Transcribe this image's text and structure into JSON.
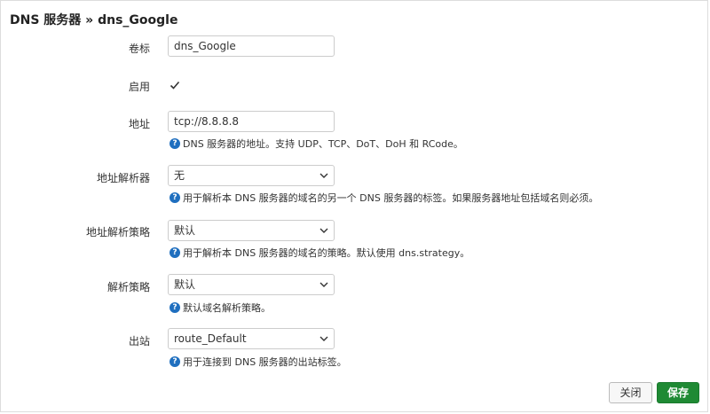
{
  "dialog": {
    "title": "DNS 服务器 » dns_Google"
  },
  "fields": {
    "label": {
      "label": "卷标",
      "value": "dns_Google"
    },
    "enabled": {
      "label": "启用",
      "checked": true
    },
    "address": {
      "label": "地址",
      "value": "tcp://8.8.8.8",
      "help": "DNS 服务器的地址。支持 UDP、TCP、DoT、DoH 和 RCode。"
    },
    "address_resolver": {
      "label": "地址解析器",
      "value": "无",
      "help": "用于解析本 DNS 服务器的域名的另一个 DNS 服务器的标签。如果服务器地址包括域名则必须。"
    },
    "address_strategy": {
      "label": "地址解析策略",
      "value": "默认",
      "help": "用于解析本 DNS 服务器的域名的策略。默认使用 dns.strategy。"
    },
    "resolve_strategy": {
      "label": "解析策略",
      "value": "默认",
      "help": "默认域名解析策略。"
    },
    "outbound": {
      "label": "出站",
      "value": "route_Default",
      "help": "用于连接到 DNS 服务器的出站标签。"
    }
  },
  "buttons": {
    "close": "关闭",
    "save": "保存"
  },
  "icons": {
    "help": "help-circle-icon",
    "chevron": "chevron-down-icon",
    "check": "check-icon"
  },
  "colors": {
    "save_button": "#1f8a34",
    "help_icon": "#1f6fbf"
  }
}
